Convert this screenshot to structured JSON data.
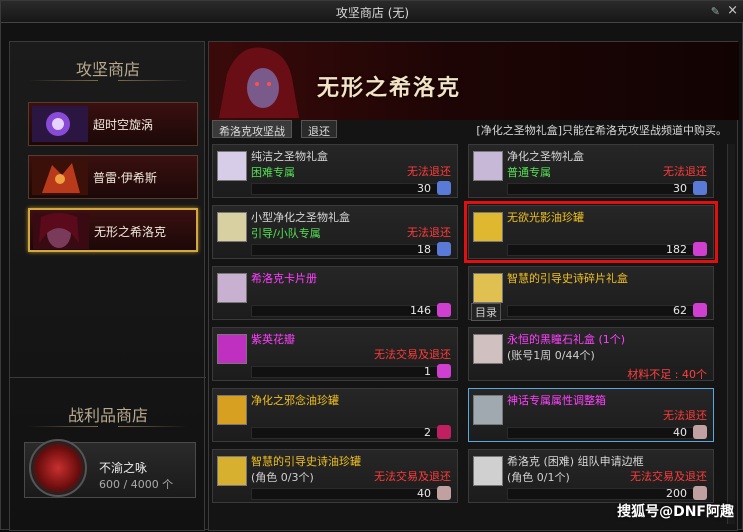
{
  "window": {
    "title": "攻坚商店 (无)"
  },
  "left": {
    "header": "攻坚商店",
    "dungeons": [
      {
        "label": "超时空旋涡"
      },
      {
        "label": "普雷·伊希斯"
      },
      {
        "label": "无形之希洛克"
      }
    ],
    "reward_header": "战利品商店",
    "reward": {
      "name": "不渝之咏",
      "count": "600 / 4000 个"
    }
  },
  "right": {
    "banner_name": "无形之希洛克",
    "tabs": [
      "希洛克攻坚战",
      "退还"
    ],
    "notice": "[净化之圣物礼盒]只能在希洛克攻坚战频道中购买。"
  },
  "items": [
    {
      "name": "纯洁之圣物礼盒",
      "sub": "困难专属",
      "warn": "无法退还",
      "price": "30"
    },
    {
      "name": "净化之圣物礼盒",
      "sub": "普通专属",
      "warn": "无法退还",
      "price": "30"
    },
    {
      "name": "小型净化之圣物礼盒",
      "sub": "引导/小队专属",
      "warn": "无法退还",
      "price": "18"
    },
    {
      "name": "无欲光影油珍罐",
      "price": "182"
    },
    {
      "name": "希洛克卡片册",
      "price": "146"
    },
    {
      "name": "智慧的引导史诗碎片礼盒",
      "tag": "目录",
      "price": "62"
    },
    {
      "name": "紫英花瓣",
      "warn": "无法交易及退还",
      "price": "1"
    },
    {
      "name": "永恒的黑瞳石礼盒 (1个)",
      "sub": "(账号1周 0/44个)",
      "warn": "材料不足 : 40个"
    },
    {
      "name": "净化之邪念油珍罐",
      "price": "2"
    },
    {
      "name": "神话专属属性调整箱",
      "warn": "无法退还",
      "price": "40"
    },
    {
      "name": "智慧的引导史诗油珍罐",
      "sub": "(角色 0/3个)",
      "warn": "无法交易及退还",
      "price": "40"
    },
    {
      "name": "希洛克 (困难) 组队申请边框",
      "sub": "(角色 0/1个)",
      "warn": "无法交易及退还",
      "price": "200"
    }
  ],
  "watermark": "搜狐号@DNF阿趣",
  "colors": {
    "red_highlight": "#e01010",
    "blue_highlight": "#5aa8e0",
    "gold": "#d2a93a"
  }
}
